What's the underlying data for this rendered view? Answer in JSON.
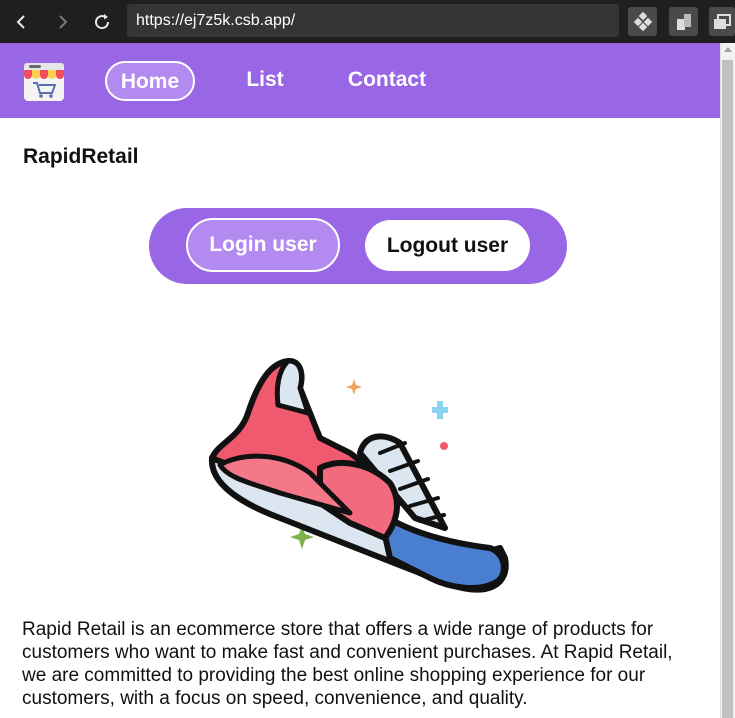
{
  "browser": {
    "url": "https://ej7z5k.csb.app/"
  },
  "nav": {
    "logo_icon": "shop-cart-icon",
    "links": [
      {
        "label": "Home"
      },
      {
        "label": "List"
      },
      {
        "label": "Contact"
      }
    ]
  },
  "brand": {
    "title": "RapidRetail"
  },
  "auth": {
    "login_label": "Login user",
    "logout_label": "Logout user"
  },
  "hero": {
    "image_icon": "sneaker-illustration"
  },
  "description": {
    "text": "Rapid Retail is an ecommerce store that offers a wide range of products for customers who want to make fast and convenient purchases. At Rapid Retail, we are committed to providing the best online shopping experience for our customers, with a focus on speed, convenience, and quality."
  },
  "colors": {
    "accent": "#9966e6",
    "accent_light": "#b38af0",
    "browser_bg": "#1f1f1f"
  }
}
